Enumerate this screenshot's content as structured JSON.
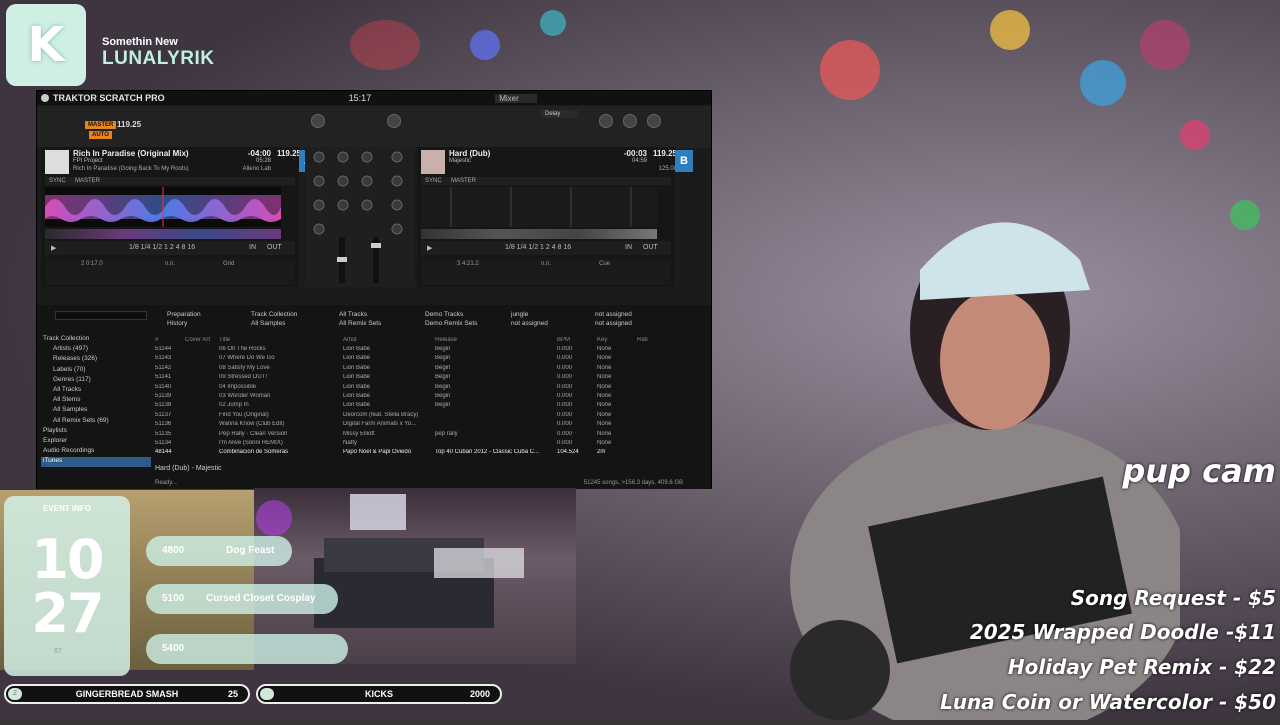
{
  "brand": {
    "subtitle": "Somethin New",
    "name": "LUNALYRIK",
    "logo_letter": "K"
  },
  "traktor": {
    "app_title": "TRAKTOR SCRATCH PRO",
    "clock": "15:17",
    "mixer_mode": "Mixer",
    "fx_effect": "Delay",
    "deck_a": {
      "title": "Rich In Paradise (Original Mix)",
      "artist": "FPI Project",
      "album": "Rich In Paradise (Going Back To My Roots)",
      "label": "Alleno Lab",
      "remaining": "-04:00",
      "duration": "05:28",
      "key_offset": "120.27",
      "bpm": "119.25",
      "pitch": "-0.8%",
      "letter": "A",
      "position": "2 0:17.0",
      "key": "n.n.",
      "mode": "Grid",
      "sync": "SYNC",
      "master": "MASTER"
    },
    "deck_b": {
      "title": "Hard (Dub)",
      "artist": "Majestic",
      "remaining": "-00:03",
      "duration": "04:59",
      "bpm": "119.25",
      "pitch": "-0.8%",
      "bpm2": "125.00",
      "letter": "B",
      "position": "3 4:21.2",
      "key": "n.n.",
      "mode": "Cue",
      "sync": "SYNC",
      "master": "MASTER"
    },
    "loop_sizes": [
      "1/8",
      "1/4",
      "1/2",
      "1",
      "2",
      "4",
      "8",
      "16"
    ],
    "favorites": [
      "Preparation",
      "Track Collection",
      "All Tracks",
      "Demo Tracks",
      "jungle",
      "not assigned",
      "History",
      "All Samples",
      "All Remix Sets",
      "Demo Remix Sets",
      "not assigned",
      "not assigned"
    ],
    "tree": [
      "Track Collection",
      "Artists (497)",
      "Releases (326)",
      "Labels (70)",
      "Genres (117)",
      "All Tracks",
      "All Stems",
      "All Samples",
      "All Remix Sets (69)",
      "Playlists",
      "Explorer",
      "Audio Recordings",
      "iTunes"
    ],
    "columns": [
      "#",
      "Cover Art",
      "Title",
      "Artist",
      "Release",
      "BPM",
      "Key",
      "Rati"
    ],
    "rows": [
      [
        "51144",
        "",
        "06 On The Rocks",
        "Lion Babe",
        "Begin",
        "0.000",
        "None"
      ],
      [
        "51143",
        "",
        "07 Where Do We Go",
        "Lion Babe",
        "Begin",
        "0.000",
        "None"
      ],
      [
        "51142",
        "",
        "08 Satisfy My Love",
        "Lion Babe",
        "Begin",
        "0.000",
        "None"
      ],
      [
        "51141",
        "",
        "09 Stressed OUT!",
        "Lion Babe",
        "Begin",
        "0.000",
        "None"
      ],
      [
        "51140",
        "",
        "04 Impossible",
        "Lion Babe",
        "Begin",
        "0.000",
        "None"
      ],
      [
        "51139",
        "",
        "03 Wonder Woman",
        "Lion Babe",
        "Begin",
        "0.000",
        "None"
      ],
      [
        "51138",
        "",
        "02 Jump In",
        "Lion Babe",
        "Begin",
        "0.000",
        "None"
      ],
      [
        "51137",
        "",
        "Find You (Original)",
        "Deorcom (feat. Stella Bracy)",
        "",
        "0.000",
        "None"
      ],
      [
        "51136",
        "",
        "Wanna Know (Club Edit)",
        "Digital Farm Animals x Yo...",
        "",
        "0.000",
        "None"
      ],
      [
        "51135",
        "",
        "Pep Rally - Clean Version",
        "Missy Elliott",
        "pep rally",
        "0.000",
        "None"
      ],
      [
        "51134",
        "",
        "I'm Alive (Sonni REMIX)",
        "Natty",
        "",
        "0.000",
        "None"
      ],
      [
        "48144",
        "",
        "Combinacion de Someras",
        "Papo Noel & Papi Oviedo",
        "Top 40 Cuban 2012 - Classic Cuba C...",
        "104.524",
        "2m"
      ]
    ],
    "now_playing": "Hard (Dub) - Majestic",
    "status_left": "Ready...",
    "status_right": "51245 songs, >156.3 days, 409.6 GB"
  },
  "event": {
    "header": "EVENT INFO",
    "day": "10",
    "month": "27",
    "count": "67"
  },
  "goals": [
    {
      "amount": "4800",
      "name": "Dog Feast"
    },
    {
      "amount": "5100",
      "name": "Cursed Closet Cosplay"
    },
    {
      "amount": "5400",
      "name": ""
    }
  ],
  "bars": [
    {
      "dot": "2",
      "label": "GINGERBREAD SMASH",
      "value": "25"
    },
    {
      "dot": "",
      "label": "KICKS",
      "value": "2000"
    }
  ],
  "pup_cam": "pup cam",
  "prices": [
    "Song Request - $5",
    "2025 Wrapped Doodle -$11",
    "Holiday Pet Remix - $22",
    "Luna Coin or Watercolor - $50"
  ],
  "colors": {
    "deck_accent": "#2e7fbf",
    "orange": "#e8841c",
    "mint": "#cfeee4"
  }
}
